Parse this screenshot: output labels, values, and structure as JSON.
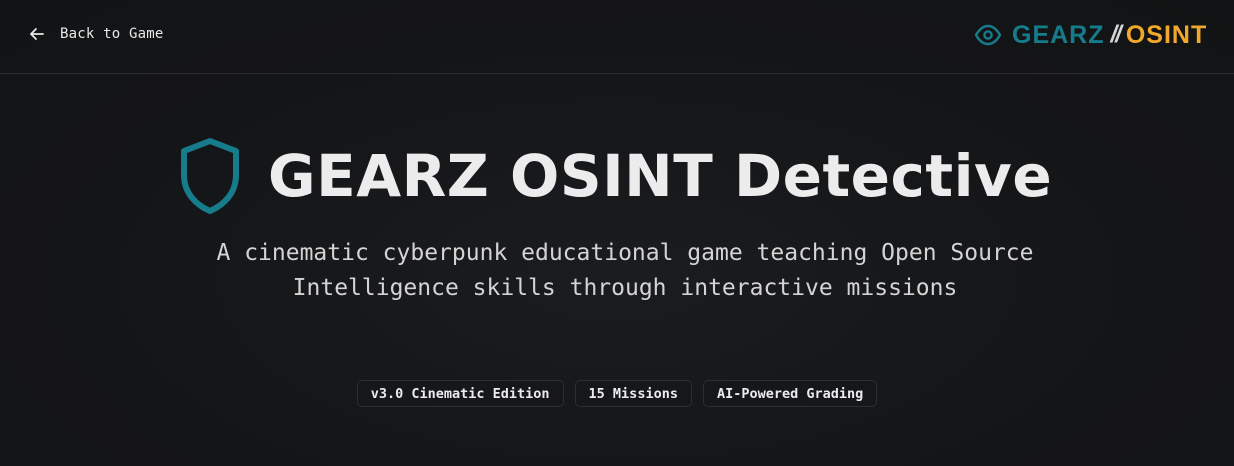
{
  "header": {
    "back_label": "Back to Game",
    "brand": {
      "part1": "GEARZ",
      "separator": "//",
      "part2": "OSINT",
      "part1_color": "#167c8c",
      "part2_color": "#f0a92a"
    }
  },
  "hero": {
    "title": "GEARZ OSINT Detective",
    "subtitle": "A cinematic cyberpunk educational game teaching Open Source Intelligence skills through interactive missions",
    "icon": "shield-icon",
    "accent_color": "#167c8c"
  },
  "badges": [
    {
      "label": "v3.0 Cinematic Edition"
    },
    {
      "label": "15 Missions"
    },
    {
      "label": "AI-Powered Grading"
    }
  ]
}
